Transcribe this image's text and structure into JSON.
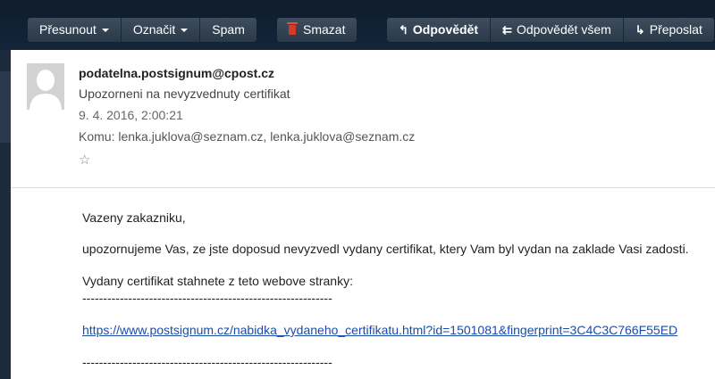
{
  "toolbar": {
    "move_label": "Přesunout",
    "mark_label": "Označit",
    "spam_label": "Spam",
    "delete_label": "Smazat",
    "reply_label": "Odpovědět",
    "reply_all_label": "Odpovědět všem",
    "forward_label": "Přeposlat"
  },
  "message": {
    "from": "podatelna.postsignum@cpost.cz",
    "subject": "Upozorneni na nevyzvednuty certifikat",
    "date": "9. 4. 2016, 2:00:21",
    "to": "Komu: lenka.juklova@seznam.cz, lenka.juklova@seznam.cz",
    "star": "☆"
  },
  "body": {
    "greeting": "Vazeny zakazniku,",
    "line1": "upozornujeme Vas, ze jste doposud nevyzvedl vydany certifikat, ktery Vam byl vydan na zaklade Vasi zadosti.",
    "line2": "Vydany certifikat stahnete z teto webove stranky:",
    "separator1": "------------------------------------------------------------",
    "link": "https://www.postsignum.cz/nabidka_vydaneho_certifikatu.html?id=1501081&fingerprint=3C4C3C766F55ED",
    "separator2": "------------------------------------------------------------"
  },
  "icons": {
    "reply": "reply-arrow-icon",
    "reply_all": "reply-all-arrow-icon",
    "forward": "forward-arrow-icon",
    "delete": "trash-icon"
  }
}
